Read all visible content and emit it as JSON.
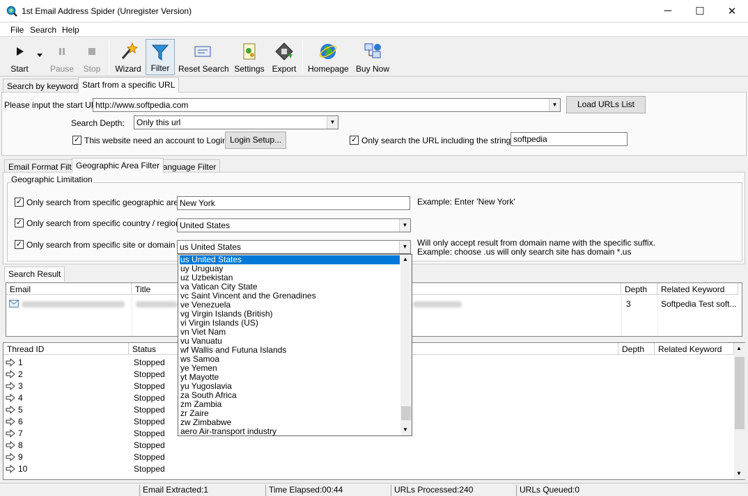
{
  "window": {
    "title": "1st Email Address Spider (Unregister Version)"
  },
  "menu": [
    "File",
    "Search",
    "Help"
  ],
  "toolbar": {
    "start": "Start",
    "pause": "Pause",
    "stop": "Stop",
    "wizard": "Wizard",
    "filter": "Filter",
    "reset_search": "Reset Search",
    "settings": "Settings",
    "export": "Export",
    "homepage": "Homepage",
    "buy_now": "Buy Now"
  },
  "search_tabs": [
    "Search by keywords",
    "Start from a specific URL"
  ],
  "url_form": {
    "start_url_label": "Please input the start URL:",
    "start_url_value": "http://www.softpedia.com",
    "load_urls_button": "Load URLs List",
    "depth_label": "Search Depth:",
    "depth_value": "Only this url",
    "login_checkbox_label": "This website need an account to Login",
    "login_setup_button": "Login Setup...",
    "only_url_checkbox_label": "Only search the URL including the string :",
    "only_url_value": "softpedia"
  },
  "filter_tabs": [
    "Email Format Filter",
    "Geographic Area Filter",
    "Language Filter"
  ],
  "geo": {
    "group_title": "Geographic Limitation",
    "area_label": "Only search from specific geographic area",
    "area_value": "New York",
    "area_example": "Example: Enter 'New York'",
    "country_label": "Only search from specific country / region",
    "country_value": "United States",
    "domain_label": "Only search from specific site or domain",
    "domain_value": "us United States",
    "domain_note_1": "Will only accept result from domain name with the specific suffix.",
    "domain_note_2": "Example: choose .us will only search site has domain *.us"
  },
  "domain_options": [
    "us United States",
    "uy Uruguay",
    "uz Uzbekistan",
    "va Vatican City State",
    "vc Saint Vincent and the Grenadines",
    "ve Venezuela",
    "vg Virgin Islands (British)",
    "vi Virgin Islands (US)",
    "vn Viet Nam",
    "vu Vanuatu",
    "wf Wallis and Futuna Islands",
    "ws Samoa",
    "ye Yemen",
    "yt Mayotte",
    "yu Yugoslavia",
    "za South Africa",
    "zm Zambia",
    "zr Zaire",
    "zw Zimbabwe",
    "aero Air-transport industry"
  ],
  "search_result": {
    "tab": "Search Result",
    "columns": [
      "Email",
      "Title",
      "Depth",
      "Related Keyword"
    ],
    "rows": [
      {
        "depth": "3",
        "keyword": "Softpedia Test soft..."
      }
    ]
  },
  "threads": {
    "columns": [
      "Thread ID",
      "Status",
      "Depth",
      "Related Keyword"
    ],
    "rows": [
      {
        "id": "1",
        "status": "Stopped"
      },
      {
        "id": "2",
        "status": "Stopped"
      },
      {
        "id": "3",
        "status": "Stopped"
      },
      {
        "id": "4",
        "status": "Stopped"
      },
      {
        "id": "5",
        "status": "Stopped"
      },
      {
        "id": "6",
        "status": "Stopped"
      },
      {
        "id": "7",
        "status": "Stopped"
      },
      {
        "id": "8",
        "status": "Stopped"
      },
      {
        "id": "9",
        "status": "Stopped"
      },
      {
        "id": "10",
        "status": "Stopped"
      }
    ]
  },
  "status": {
    "emails": "Email Extracted:1",
    "time": "Time Elapsed:00:44",
    "processed": "URLs Processed:240",
    "queued": "URLs Queued:0"
  },
  "colors": {
    "selection": "#0078d7",
    "window": "#f0f0f0"
  }
}
